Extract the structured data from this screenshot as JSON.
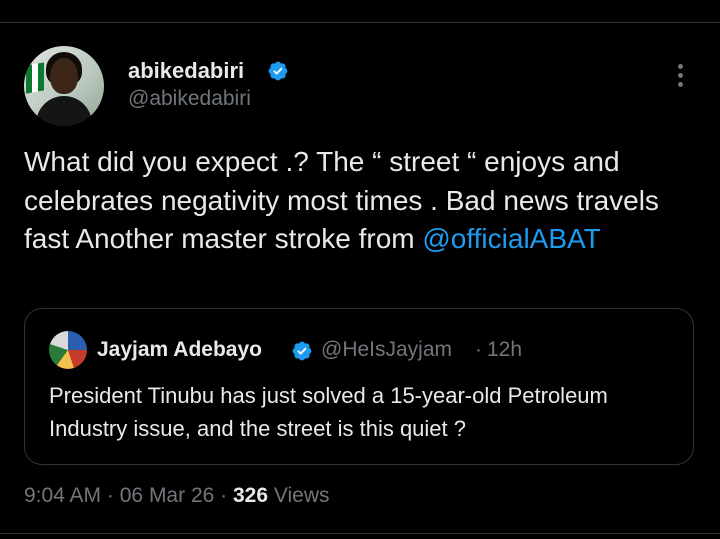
{
  "tweet": {
    "author_name": "abikedabiri",
    "author_handle": "@abikedabiri",
    "text": "What did you expect .? The “ street “ enjoys and celebrates negativity most times . Bad news travels fast Another master stroke from ",
    "mention": "@officialABAT",
    "time": "9:04 AM",
    "date": "06 Mar 26",
    "views_count": "326",
    "views_label": "Views"
  },
  "quote": {
    "author_name": "Jayjam Adebayo",
    "author_handle": "@HeIsJayjam",
    "separator": "·",
    "time": "12h",
    "text": "President Tinubu has just solved a 15-year-old Petroleum Industry issue, and the street is this quiet ?"
  },
  "meta": {
    "separator": "·"
  },
  "icons": {
    "verified": "verified-badge-icon",
    "more": "more-vertical-icon"
  },
  "colors": {
    "background": "#000000",
    "text": "#e7e9ea",
    "secondary": "#71767b",
    "accent": "#1d9bf0",
    "border": "#2f3336"
  }
}
